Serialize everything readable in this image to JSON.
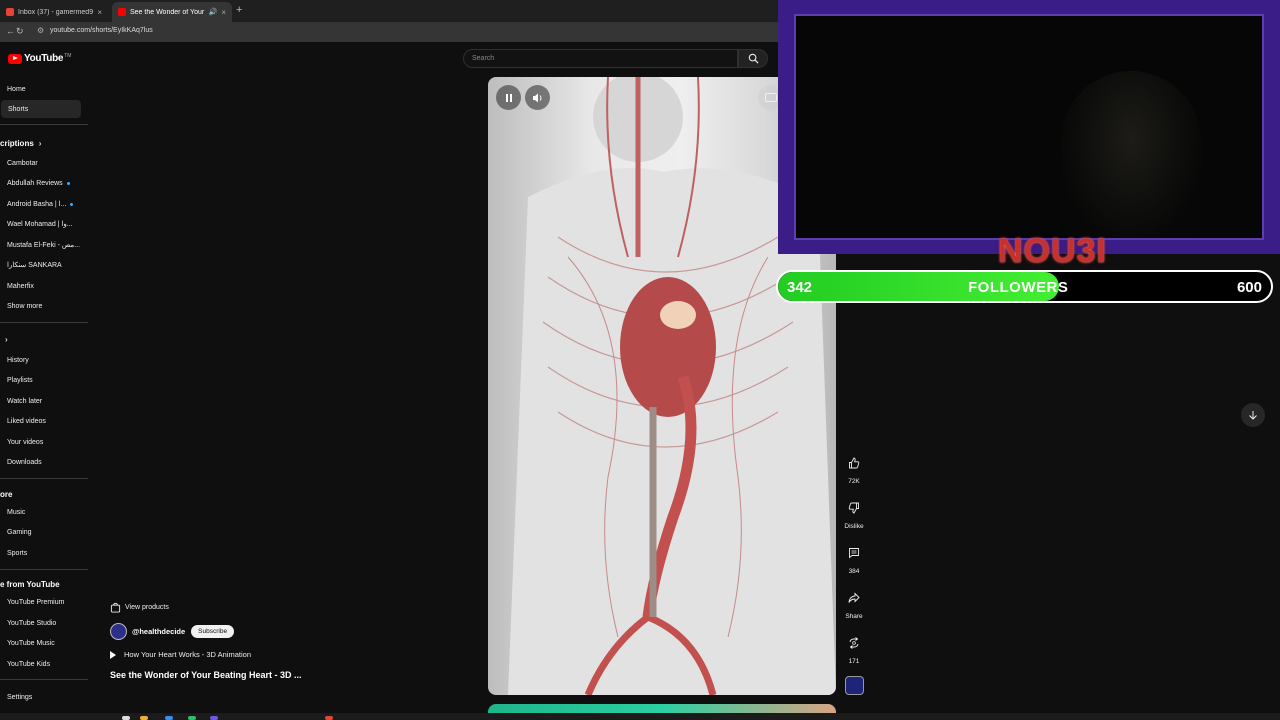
{
  "browser": {
    "tabs": [
      {
        "label": "Inbox (37) - gamermed97@gm",
        "close": "×"
      },
      {
        "label": "See the Wonder of Your Be",
        "close": "×"
      }
    ],
    "new_tab": "+",
    "url": "youtube.com/shorts/EyIkKAq7lus"
  },
  "youtube": {
    "logo_text": "YouTube",
    "logo_tm": "TM",
    "search_placeholder": "Search"
  },
  "sidebar": {
    "main": [
      {
        "label": "Home"
      },
      {
        "label": "Shorts",
        "active": true
      }
    ],
    "subscriptions_header": "criptions",
    "subscriptions": [
      {
        "label": "Cambotar",
        "dot": false
      },
      {
        "label": "Abdullah Reviews",
        "dot": true
      },
      {
        "label": "Android Basha | ا...",
        "dot": true
      },
      {
        "label": "Wael Mohamad | وا...",
        "dot": false
      },
      {
        "label": "Mustafa El-Feki - مص...",
        "dot": false
      },
      {
        "label": "سنكارا SANKARA",
        "dot": false
      },
      {
        "label": "Maherfix",
        "dot": false
      },
      {
        "label": "Show more",
        "dot": false
      }
    ],
    "you_header": "",
    "you": [
      {
        "label": "History"
      },
      {
        "label": "Playlists"
      },
      {
        "label": "Watch later"
      },
      {
        "label": "Liked videos"
      },
      {
        "label": "Your videos"
      },
      {
        "label": "Downloads"
      }
    ],
    "explore_header": "ore",
    "explore": [
      {
        "label": "Music"
      },
      {
        "label": "Gaming"
      },
      {
        "label": "Sports"
      }
    ],
    "more_header": "e from YouTube",
    "more": [
      {
        "label": "YouTube Premium"
      },
      {
        "label": "YouTube Studio"
      },
      {
        "label": "YouTube Music"
      },
      {
        "label": "YouTube Kids"
      }
    ],
    "settings": "Settings"
  },
  "short": {
    "view_products": "View products",
    "channel": "@healthdecide",
    "subscribe": "Subscribe",
    "related": "How Your Heart Works - 3D Animation",
    "title": "See the Wonder of Your Beating Heart - 3D ..."
  },
  "actions": {
    "like": "72K",
    "dislike": "Dislike",
    "comments": "384",
    "share": "Share",
    "remix": "171"
  },
  "overlay": {
    "streamer_name": "NOU3I",
    "followers_current": "342",
    "followers_label": "FOLLOWERS",
    "followers_goal": "600",
    "progress": 0.57
  },
  "colors": {
    "yt_red": "#ff0000",
    "overlay_purple": "#3a1d86",
    "goal_green": "#33dd22",
    "streamer_red": "#c9302c"
  }
}
